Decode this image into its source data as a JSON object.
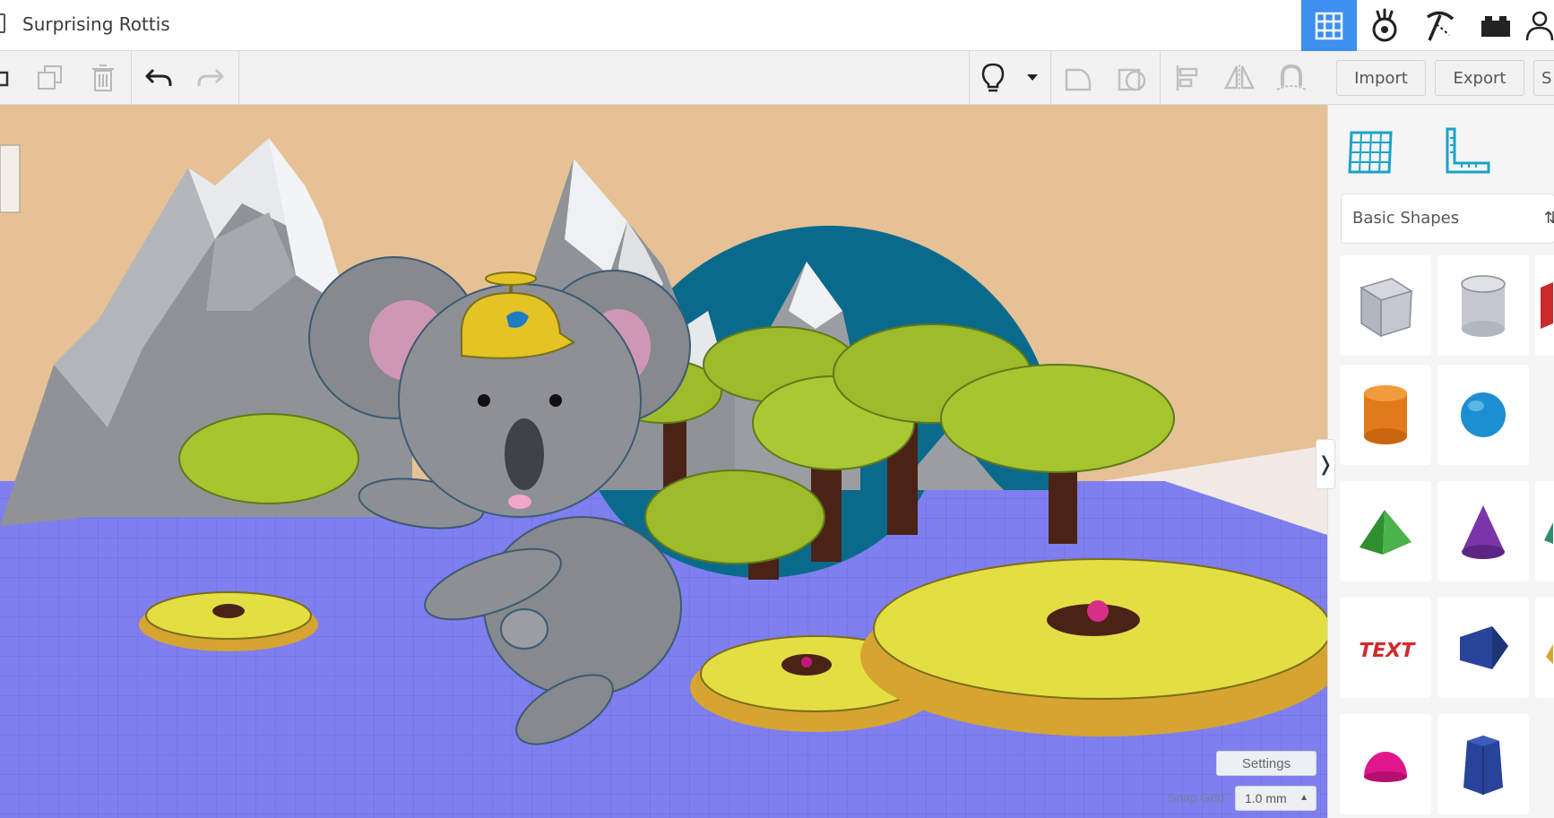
{
  "app": {
    "title": "Surprising Rottis"
  },
  "top_views": [
    {
      "name": "3d-design-view",
      "icon": "grid-icon",
      "active": true
    },
    {
      "name": "blocks-view",
      "icon": "hand-icon",
      "active": false
    },
    {
      "name": "bricks-view",
      "icon": "pickaxe-icon",
      "active": false
    },
    {
      "name": "lego-view",
      "icon": "brick-icon",
      "active": false
    },
    {
      "name": "profile",
      "icon": "user-icon",
      "active": false
    }
  ],
  "toolbar": {
    "import_label": "Import",
    "export_label": "Export",
    "share_label": "S"
  },
  "workplane": {
    "settings_label": "Settings",
    "snap_grid_label": "Snap Grid",
    "snap_grid_value": "1.0 mm",
    "collapse_glyph": "❭"
  },
  "panel": {
    "library_label": "Basic Shapes",
    "library_caret": "⇅",
    "shapes": [
      {
        "name": "box-hole",
        "color": "#b6bac6"
      },
      {
        "name": "cylinder-hole",
        "color": "#b6bac6"
      },
      {
        "name": "box-red",
        "color": "#c92a2a"
      },
      {
        "name": "cylinder",
        "color": "#e07a1a"
      },
      {
        "name": "sphere",
        "color": "#1b8fd1"
      },
      {
        "name": "roof",
        "color": "#3aa53a"
      },
      {
        "name": "cone",
        "color": "#7a36a8"
      },
      {
        "name": "text",
        "color": "#d12b2b",
        "label": "TEXT"
      },
      {
        "name": "wedge",
        "color": "#28449a"
      },
      {
        "name": "half-sphere",
        "color": "#e0178c"
      },
      {
        "name": "polygon",
        "color": "#28449a"
      }
    ]
  },
  "colors": {
    "accent": "#3d8ff0",
    "sky": "#e6c196",
    "grid_floor": "#7f7ff0",
    "mountain": "#9a9ea3",
    "palm_leaf": "#9dbb2a",
    "flower": "#e3df43"
  }
}
